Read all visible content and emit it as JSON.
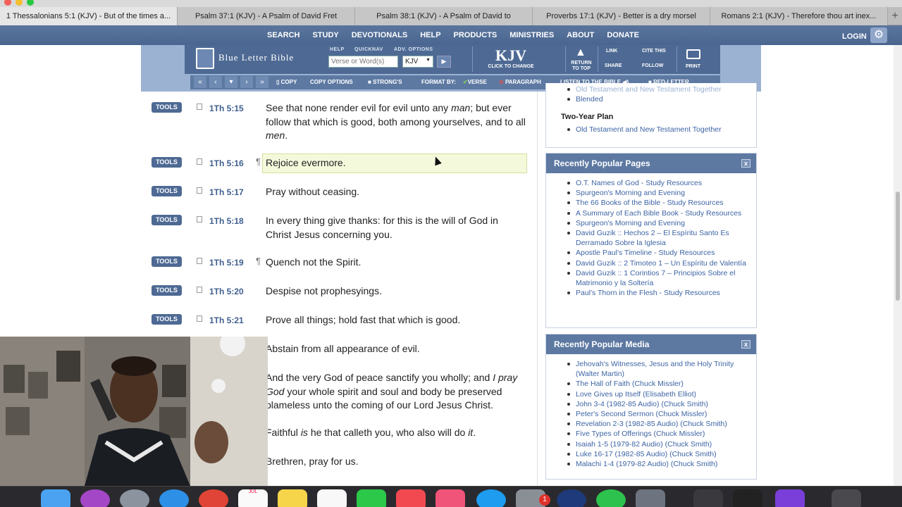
{
  "browser": {
    "tabs": [
      {
        "title": "1 Thessalonians 5:1 (KJV) - But of the times a...",
        "active": true
      },
      {
        "title": "Psalm 37:1 (KJV) - A Psalm of David Fret",
        "active": false
      },
      {
        "title": "Psalm 38:1 (KJV) - A Psalm of David to",
        "active": false
      },
      {
        "title": "Proverbs 17:1 (KJV) - Better is a dry morsel",
        "active": false
      },
      {
        "title": "Romans 2:1 (KJV) - Therefore thou art inex...",
        "active": false
      }
    ],
    "new_tab": "+"
  },
  "nav": {
    "items": [
      "SEARCH",
      "STUDY",
      "DEVOTIONALS",
      "HELP",
      "PRODUCTS",
      "MINISTRIES",
      "ABOUT",
      "DONATE"
    ],
    "login": "LOGIN"
  },
  "header": {
    "logo": "Blue Letter Bible",
    "labels": {
      "help": "HELP",
      "quicknav": "QUICKNAV",
      "adv_options": "ADV. OPTIONS"
    },
    "search_placeholder": "Verse or Word(s)",
    "version_select": "KJV",
    "version_big": "KJV",
    "version_sub": "CLICK TO CHANGE",
    "return_to_top": "RETURN TO TOP",
    "link": "LINK",
    "cite_this": "CITE THIS",
    "share": "SHARE",
    "follow": "FOLLOW",
    "print": "PRINT"
  },
  "toolbar": {
    "copy": "COPY",
    "copy_options": "COPY OPTIONS",
    "strongs": "STRONG'S",
    "format_by": "FORMAT BY:",
    "verse": "VERSE",
    "paragraph": "PARAGRAPH",
    "listen": "LISTEN TO THE BIBLE",
    "red_letter": "RED-LETTER"
  },
  "verses": [
    {
      "tools": "TOOLS",
      "ref": "1Th 5:15",
      "pilcrow": "",
      "text": "See that none render evil for evil unto any <i>man</i>; but ever follow that which is good, both among yourselves, and to all <i>men</i>."
    },
    {
      "tools": "TOOLS",
      "ref": "1Th 5:16",
      "pilcrow": "¶",
      "text": "Rejoice evermore."
    },
    {
      "tools": "TOOLS",
      "ref": "1Th 5:17",
      "pilcrow": "",
      "text": "Pray without ceasing."
    },
    {
      "tools": "TOOLS",
      "ref": "1Th 5:18",
      "pilcrow": "",
      "text": "In every thing give thanks: for this is the will of God in Christ Jesus concerning you."
    },
    {
      "tools": "TOOLS",
      "ref": "1Th 5:19",
      "pilcrow": "¶",
      "text": "Quench not the Spirit."
    },
    {
      "tools": "TOOLS",
      "ref": "1Th 5:20",
      "pilcrow": "",
      "text": "Despise not prophesyings."
    },
    {
      "tools": "TOOLS",
      "ref": "1Th 5:21",
      "pilcrow": "",
      "text": "Prove all things; hold fast that which is good."
    },
    {
      "tools": "",
      "ref": "",
      "pilcrow": "",
      "text": "Abstain from all appearance of evil."
    },
    {
      "tools": "",
      "ref": "",
      "pilcrow": "",
      "text": "And the very God of peace sanctify you wholly; and <i>I pray God</i> your whole spirit and soul and body be preserved blameless unto the coming of our Lord Jesus Christ."
    },
    {
      "tools": "",
      "ref": "",
      "pilcrow": "",
      "text": "Faithful <i>is</i> he that calleth you, who also will do <i>it</i>."
    },
    {
      "tools": "",
      "ref": "",
      "pilcrow": "",
      "text": "Brethren, pray for us."
    }
  ],
  "reading_plan": {
    "partial_top": "Old Testament and New Testament Together",
    "blended": "Blended",
    "two_year_title": "Two-Year Plan",
    "two_year_item": "Old Testament and New Testament Together"
  },
  "popular_pages": {
    "title": "Recently Popular Pages",
    "close": "x",
    "items": [
      "O.T. Names of God - Study Resources",
      "Spurgeon's Morning and Evening",
      "The 66 Books of the Bible - Study Resources",
      "A Summary of Each Bible Book - Study Resources",
      "Spurgeon's Morning and Evening",
      "David Guzik :: Hechos 2 – El Espíritu Santo Es Derramado Sobre la Iglesia",
      "Apostle Paul's Timeline - Study Resources",
      "David Guzik :: 2 Timoteo 1 – Un Espíritu de Valentía",
      "David Guzik :: 1 Corintios 7 – Principios Sobre el Matrimonio y la Soltería",
      "Paul's Thorn in the Flesh - Study Resources"
    ]
  },
  "popular_media": {
    "title": "Recently Popular Media",
    "close": "x",
    "items": [
      "Jehovah's Witnesses, Jesus and the Holy Trinity (Walter Martin)",
      "The Hall of Faith (Chuck Missler)",
      "Love Gives up Itself (Elisabeth Elliot)",
      "John 3-4 (1982-85 Audio) (Chuck Smith)",
      "Peter's Second Sermon (Chuck Missler)",
      "Revelation 2-3 (1982-85 Audio) (Chuck Smith)",
      "Five Types of Offerings (Chuck Missler)",
      "Isaiah 1-5 (1979-82 Audio) (Chuck Smith)",
      "Luke 16-17 (1982-85 Audio) (Chuck Smith)",
      "Malachi 1-4 (1979-82 Audio) (Chuck Smith)"
    ]
  },
  "dock": {
    "badge": "1",
    "calendar_month": "JUL"
  },
  "colors": {
    "nav": "#4e6a94",
    "link": "#3d64a4",
    "highlight": "#f5f9dc"
  }
}
